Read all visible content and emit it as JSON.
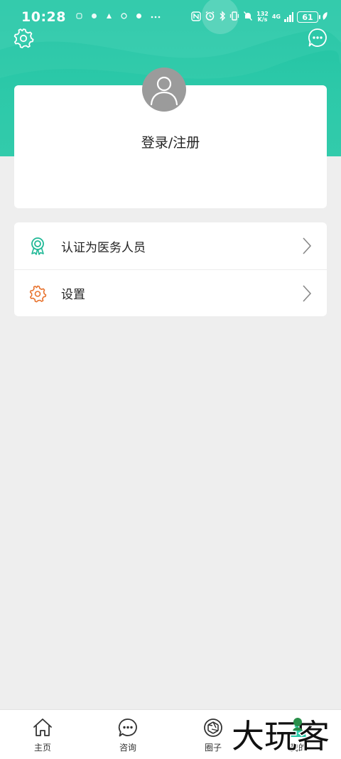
{
  "status_bar": {
    "time": "10:28",
    "speed_value": "132",
    "speed_unit": "K/s",
    "network": "4G",
    "battery": "61"
  },
  "profile": {
    "login_label": "登录/注册"
  },
  "menu": {
    "items": [
      {
        "label": "认证为医务人员",
        "icon": "certificate-badge-icon",
        "color": "#1fb896"
      },
      {
        "label": "设置",
        "icon": "gear-icon",
        "color": "#e8732e"
      }
    ]
  },
  "bottom_nav": {
    "items": [
      {
        "label": "主页",
        "icon": "home-icon"
      },
      {
        "label": "咨询",
        "icon": "chat-bubble-icon"
      },
      {
        "label": "圈子",
        "icon": "aperture-icon"
      },
      {
        "label": "我的",
        "icon": "person-icon"
      }
    ]
  },
  "watermark": {
    "text": "大玩客"
  },
  "colors": {
    "accent": "#2dc9a9",
    "background": "#eeeeee",
    "avatar": "#9b9b9b"
  }
}
